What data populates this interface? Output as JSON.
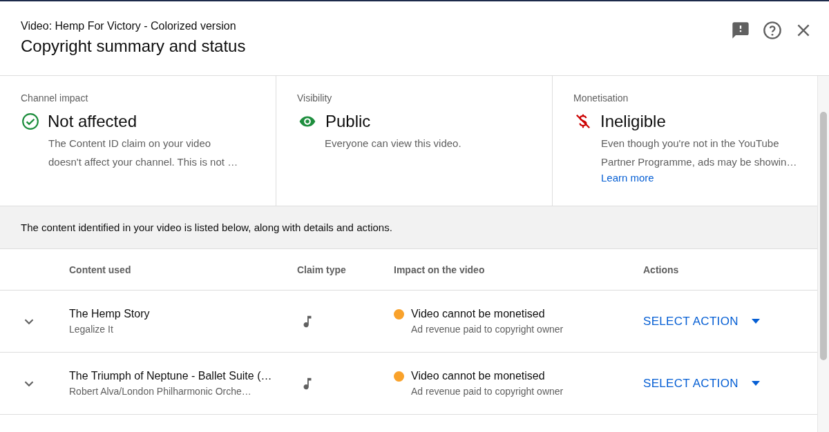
{
  "dialog": {
    "subtitle": "Video: Hemp For Victory - Colorized version",
    "title": "Copyright summary and status"
  },
  "summary_cards": [
    {
      "kind": "check",
      "label": "Channel impact",
      "status": "Not affected",
      "description": [
        "The Content ID claim on your video",
        "doesn't affect your channel. This is not …"
      ]
    },
    {
      "kind": "eye",
      "label": "Visibility",
      "status": "Public",
      "description": [
        "Everyone can view this video."
      ]
    },
    {
      "kind": "no-money",
      "label": "Monetisation",
      "status": "Ineligible",
      "description": [
        "Even though you're not in the YouTube",
        "Partner Programme, ads may be showin…"
      ],
      "link": "Learn more"
    }
  ],
  "info_text": "The content identified in your video is listed below, along with details and actions.",
  "table": {
    "columns": [
      "Content used",
      "Claim type",
      "Impact on the video",
      "Actions"
    ],
    "rows": [
      {
        "expanded": false,
        "title": "The Hemp Story",
        "subtitle": "Legalize It",
        "kind": "music",
        "color": "#f9a22b",
        "impact": "Video cannot be monetised",
        "impact_detail": "Ad revenue paid to copyright owner",
        "action": "SELECT ACTION"
      },
      {
        "expanded": false,
        "title": "The Triumph of Neptune - Ballet Suite (…",
        "subtitle": "Robert Alva/London Philharmonic Orche…",
        "kind": "music",
        "color": "#f9a22b",
        "impact": "Video cannot be monetised",
        "impact_detail": "Ad revenue paid to copyright owner",
        "action": "SELECT ACTION"
      }
    ]
  }
}
